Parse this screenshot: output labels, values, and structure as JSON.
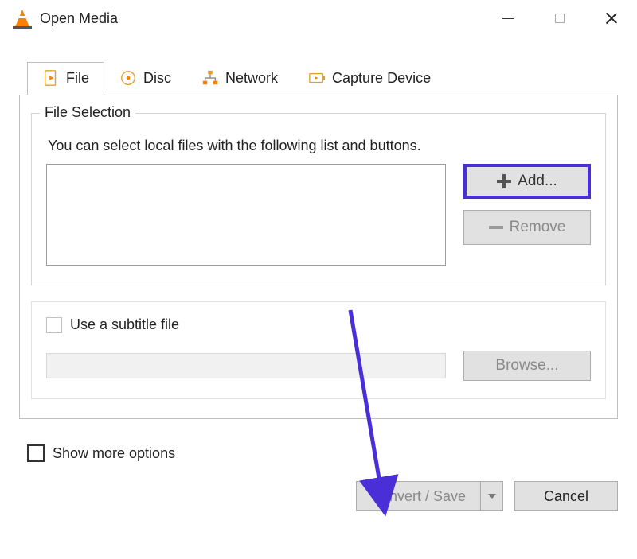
{
  "title": "Open Media",
  "tabs": {
    "file": "File",
    "disc": "Disc",
    "network": "Network",
    "capture": "Capture Device"
  },
  "file_selection": {
    "legend": "File Selection",
    "helper": "You can select local files with the following list and buttons.",
    "add_label": "Add...",
    "remove_label": "Remove"
  },
  "subtitle": {
    "label": "Use a subtitle file",
    "browse_label": "Browse..."
  },
  "more_options_label": "Show more options",
  "actions": {
    "convert_label": "Convert / Save",
    "cancel_label": "Cancel"
  }
}
